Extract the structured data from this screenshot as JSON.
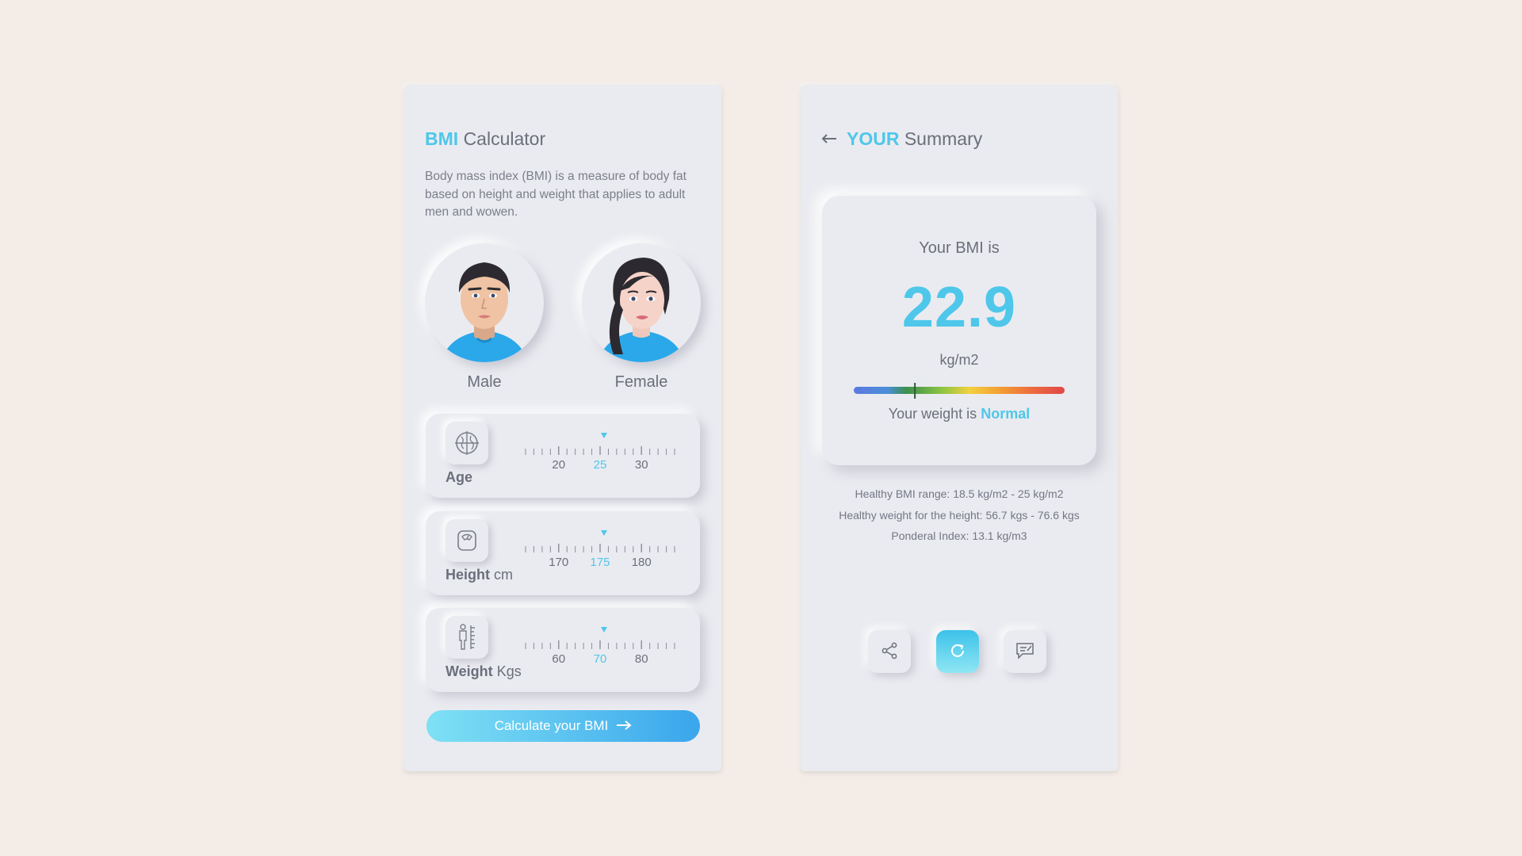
{
  "colors": {
    "background": "#f3ece7",
    "card": "#eaebf0",
    "accent": "#4ec7ea",
    "text": "#6b6f7b"
  },
  "calculator": {
    "title_accent": "BMI",
    "title_rest": "Calculator",
    "description": "Body mass index (BMI) is a measure of body fat based on height and weight that applies to adult men and wowen.",
    "genders": {
      "male": "Male",
      "female": "Female"
    },
    "sliders": [
      {
        "label": "Age",
        "unit": "",
        "icon": "globe-icon",
        "ticks": [
          "20",
          "25",
          "30"
        ],
        "selected": "25"
      },
      {
        "label": "Height",
        "unit": "cm",
        "icon": "scale-icon",
        "ticks": [
          "170",
          "175",
          "180"
        ],
        "selected": "175"
      },
      {
        "label": "Weight",
        "unit": "Kgs",
        "icon": "body-measure-icon",
        "ticks": [
          "60",
          "70",
          "80"
        ],
        "selected": "70"
      }
    ],
    "button_label": "Calculate your BMI",
    "button_icon": "arrow-right-icon"
  },
  "summary": {
    "back_icon": "arrow-left-icon",
    "title_accent": "YOUR",
    "title_rest": "Summary",
    "bmi_intro": "Your BMI is",
    "bmi_value": "22.9",
    "bmi_unit": "kg/m2",
    "weight_status_prefix": "Your weight is",
    "weight_status": "Normal",
    "scale_marker_fraction": 0.29,
    "details": [
      "Healthy BMI range: 18.5 kg/m2 - 25 kg/m2",
      "Healthy weight for the height: 56.7 kgs - 76.6 kgs",
      "Ponderal Index: 13.1 kg/m3"
    ],
    "actions": [
      "share-icon",
      "refresh-icon",
      "feedback-icon"
    ]
  }
}
